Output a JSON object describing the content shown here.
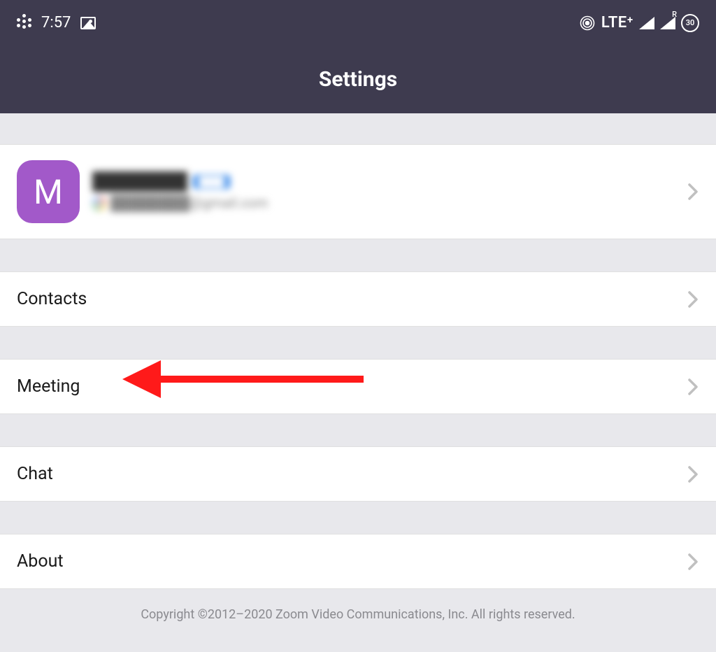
{
  "statusbar": {
    "time": "7:57",
    "network": "LTE⁺",
    "roaming_label": "R",
    "battery_pct": "30"
  },
  "header": {
    "title": "Settings"
  },
  "profile": {
    "initial": "M",
    "name": "████████",
    "tag": "████",
    "email": "████████@gmail.com"
  },
  "menu": {
    "contacts": "Contacts",
    "meeting": "Meeting",
    "chat": "Chat",
    "about": "About"
  },
  "footer": {
    "copyright": "Copyright ©2012–2020 Zoom Video Communications, Inc. All rights reserved."
  },
  "annotation": {
    "type": "arrow",
    "target": "meeting",
    "color": "#ff1a1a"
  }
}
